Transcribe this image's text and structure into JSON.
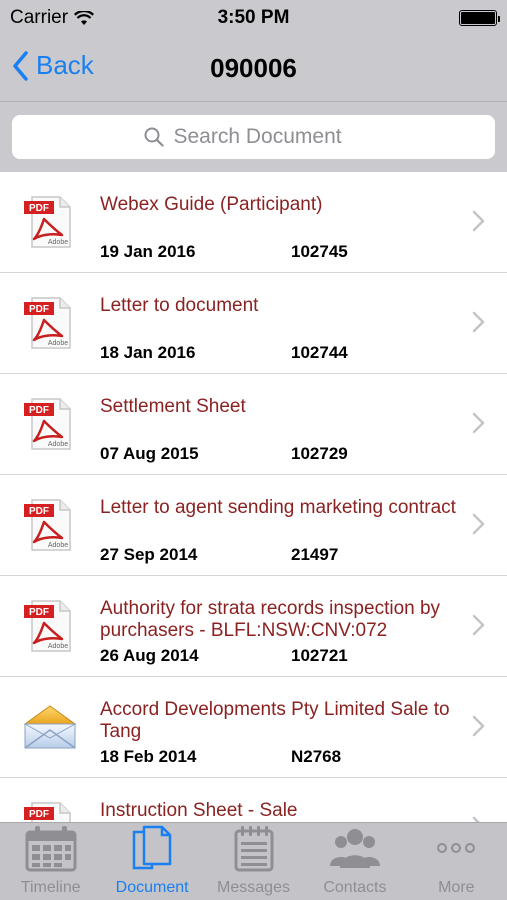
{
  "status": {
    "carrier": "Carrier",
    "time": "3:50 PM"
  },
  "nav": {
    "back_label": "Back",
    "title": "090006"
  },
  "search": {
    "placeholder": "Search Document"
  },
  "documents": [
    {
      "title": "Webex Guide (Participant)",
      "date": "19 Jan 2016",
      "number": "102745",
      "type": "pdf"
    },
    {
      "title": "Letter to document",
      "date": "18 Jan 2016",
      "number": "102744",
      "type": "pdf"
    },
    {
      "title": "Settlement Sheet",
      "date": "07 Aug 2015",
      "number": "102729",
      "type": "pdf"
    },
    {
      "title": "Letter to agent sending marketing contract",
      "date": "27 Sep 2014",
      "number": "21497",
      "type": "pdf"
    },
    {
      "title": "Authority for strata records inspection by purchasers - BLFL:NSW:CNV:072",
      "date": "26 Aug 2014",
      "number": "102721",
      "type": "pdf"
    },
    {
      "title": "Accord Developments Pty Limited Sale to Tang",
      "date": "18 Feb 2014",
      "number": "N2768",
      "type": "email"
    },
    {
      "title": "Instruction Sheet - Sale",
      "date": "",
      "number": "",
      "type": "pdf"
    }
  ],
  "tabs": [
    {
      "label": "Timeline",
      "icon": "calendar-icon",
      "active": false
    },
    {
      "label": "Document",
      "icon": "document-icon",
      "active": true
    },
    {
      "label": "Messages",
      "icon": "notepad-icon",
      "active": false
    },
    {
      "label": "Contacts",
      "icon": "people-icon",
      "active": false
    },
    {
      "label": "More",
      "icon": "ellipsis-icon",
      "active": false
    }
  ],
  "colors": {
    "accent": "#1a7ff0",
    "title_text": "#8b2222",
    "bar_bg": "#c9c9ce",
    "tab_bg": "#c4c4c8",
    "inactive": "#8e8e93"
  }
}
